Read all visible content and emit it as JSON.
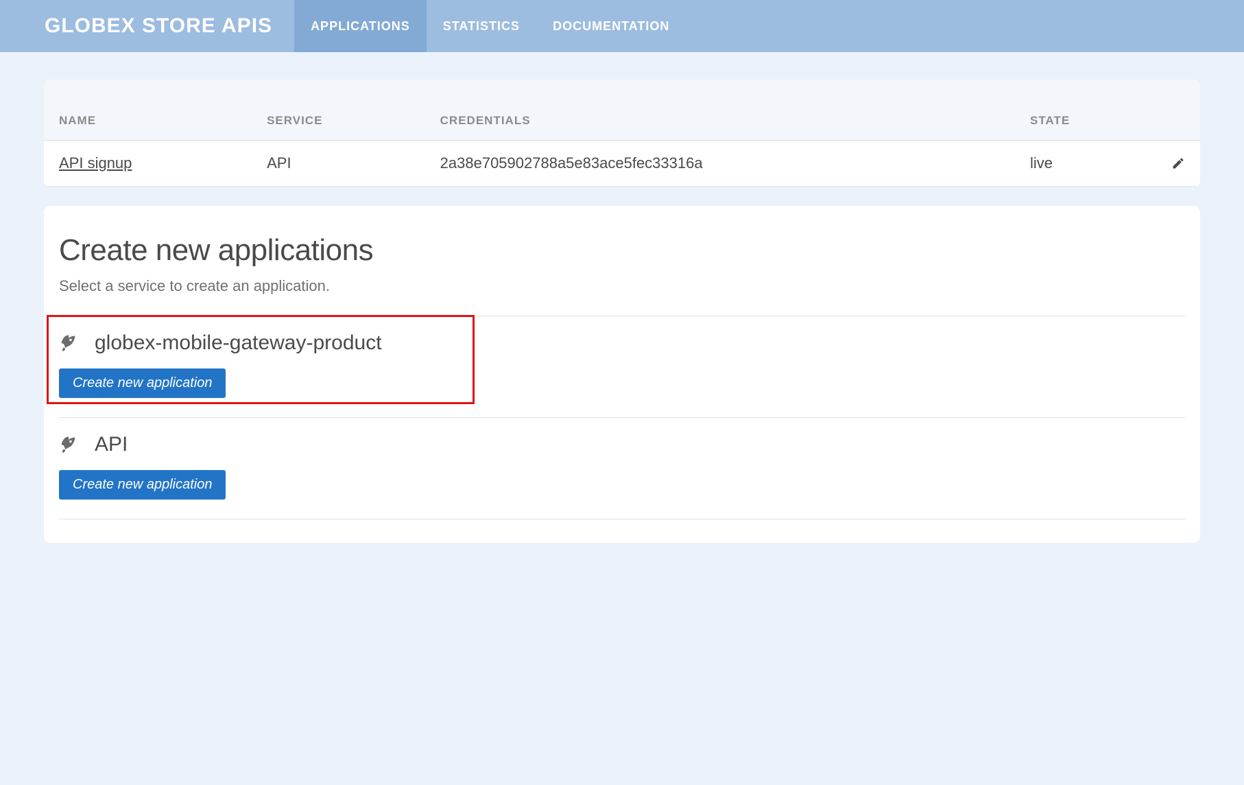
{
  "brand": "GLOBEX STORE APIS",
  "nav": {
    "items": [
      {
        "label": "APPLICATIONS",
        "active": true
      },
      {
        "label": "STATISTICS",
        "active": false
      },
      {
        "label": "DOCUMENTATION",
        "active": false
      }
    ]
  },
  "table": {
    "headers": {
      "name": "NAME",
      "service": "SERVICE",
      "credentials": "CREDENTIALS",
      "state": "STATE"
    },
    "rows": [
      {
        "name": "API signup",
        "service": "API",
        "credentials": "2a38e705902788a5e83ace5fec33316a",
        "state": "live"
      }
    ]
  },
  "create": {
    "title": "Create new applications",
    "subtitle": "Select a service to create an application.",
    "button_label": "Create new application",
    "services": [
      {
        "name": "globex-mobile-gateway-product",
        "highlighted": true
      },
      {
        "name": "API",
        "highlighted": false
      }
    ]
  }
}
